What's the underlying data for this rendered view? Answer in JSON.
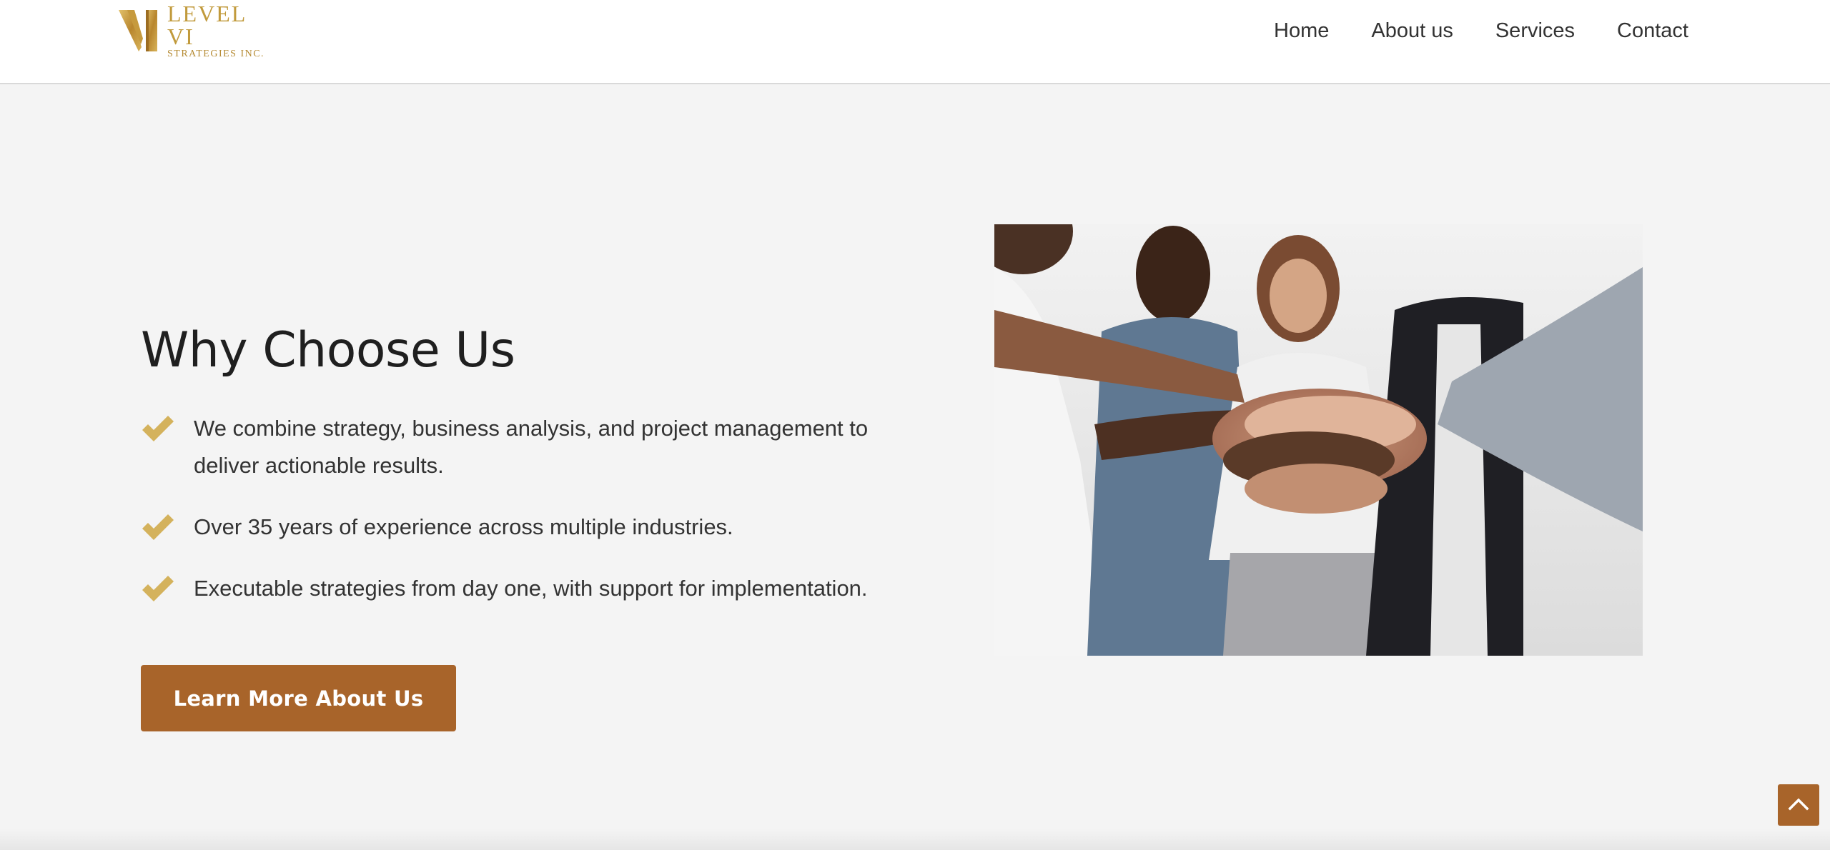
{
  "header": {
    "logo": {
      "line1": "LEVEL VI",
      "line2": "STRATEGIES INC.",
      "icon": "level-vi-logo-icon"
    },
    "nav": [
      {
        "label": "Home"
      },
      {
        "label": "About us"
      },
      {
        "label": "Services"
      },
      {
        "label": "Contact"
      }
    ]
  },
  "section": {
    "title": "Why Choose Us",
    "features": [
      {
        "text": "We combine strategy, business analysis, and project management to deliver actionable results.",
        "icon": "check-icon"
      },
      {
        "text": "Over 35 years of experience across multiple industries.",
        "icon": "check-icon"
      },
      {
        "text": "Executable strategies from day one, with support for implementation.",
        "icon": "check-icon"
      }
    ],
    "cta_label": "Learn More About Us",
    "photo_alt": "team-hands-together-photo"
  },
  "scroll_top": {
    "icon": "chevron-up-icon"
  },
  "colors": {
    "accent": "#a8642a",
    "gold": "#d4b25c",
    "background": "#f4f4f4",
    "header": "#ffffff"
  }
}
